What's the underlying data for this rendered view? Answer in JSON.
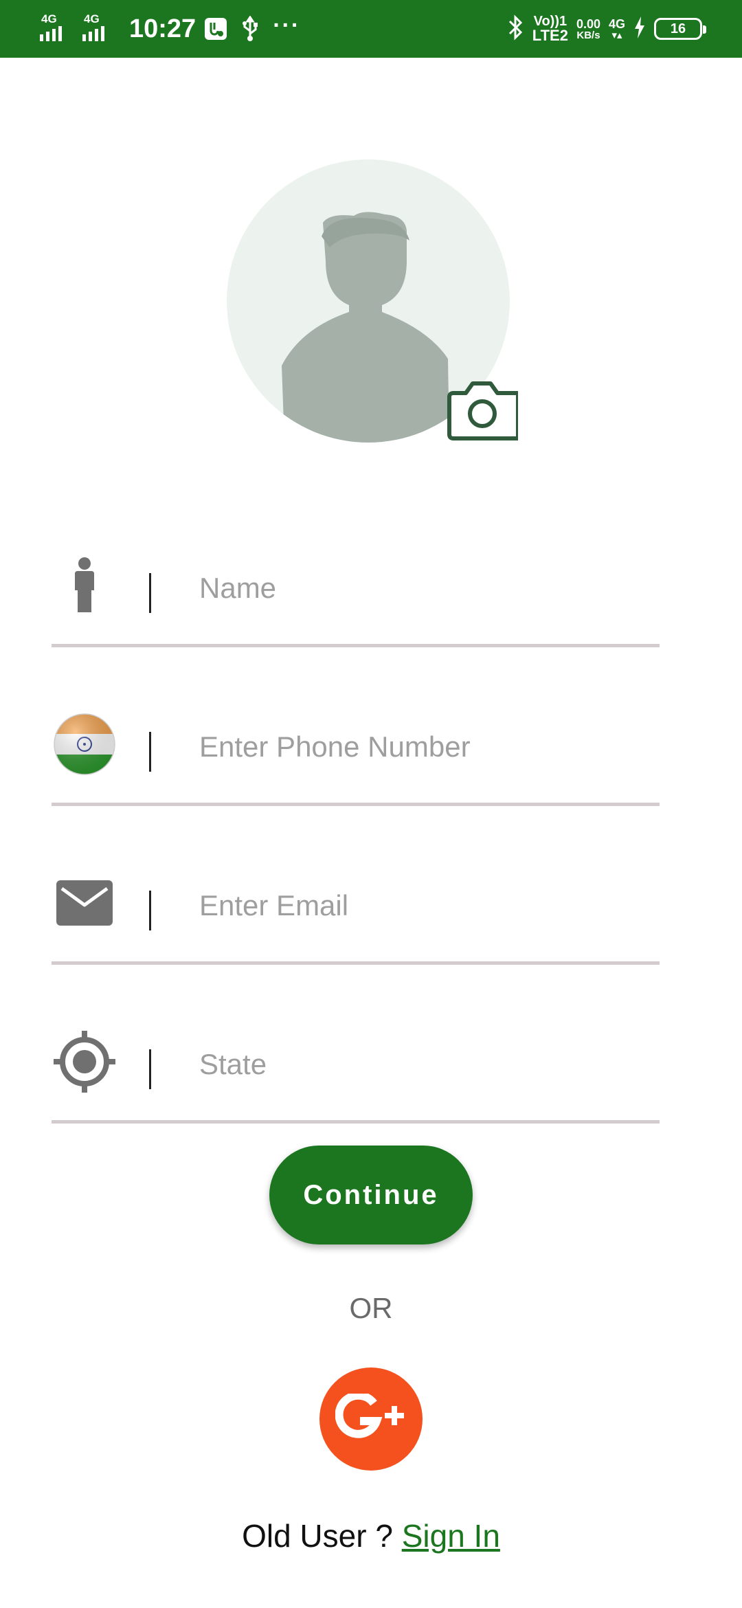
{
  "status_bar": {
    "network_1": "4G",
    "network_2": "4G",
    "time": "10:27",
    "volte_top": "Vo))1",
    "volte_bottom": "LTE2",
    "speed_value": "0.00",
    "speed_unit": "KB/s",
    "network_3": "4G",
    "battery_level": "16",
    "icons": [
      "signal-icon",
      "signal-icon",
      "app-notification-icon",
      "usb-icon",
      "more-dots-icon",
      "bluetooth-icon",
      "charging-icon",
      "battery-icon"
    ]
  },
  "profile": {
    "avatar_icon": "person-silhouette-icon",
    "camera_icon": "camera-icon"
  },
  "form": {
    "name": {
      "placeholder": "Name",
      "value": "",
      "icon": "person-icon"
    },
    "phone": {
      "placeholder": "Enter Phone Number",
      "value": "",
      "icon": "india-flag-icon"
    },
    "email": {
      "placeholder": "Enter Email",
      "value": "",
      "icon": "mail-icon"
    },
    "state": {
      "placeholder": "State",
      "value": "",
      "icon": "location-target-icon"
    }
  },
  "actions": {
    "continue_label": "Continue",
    "or_label": "OR",
    "google_icon": "google-plus-icon",
    "old_user_label": "Old User ? ",
    "sign_in_label": "Sign In"
  },
  "colors": {
    "primary_green": "#1b761f",
    "google_orange": "#f4511e",
    "field_underline": "#d3cbcd",
    "icon_gray": "#707070"
  }
}
